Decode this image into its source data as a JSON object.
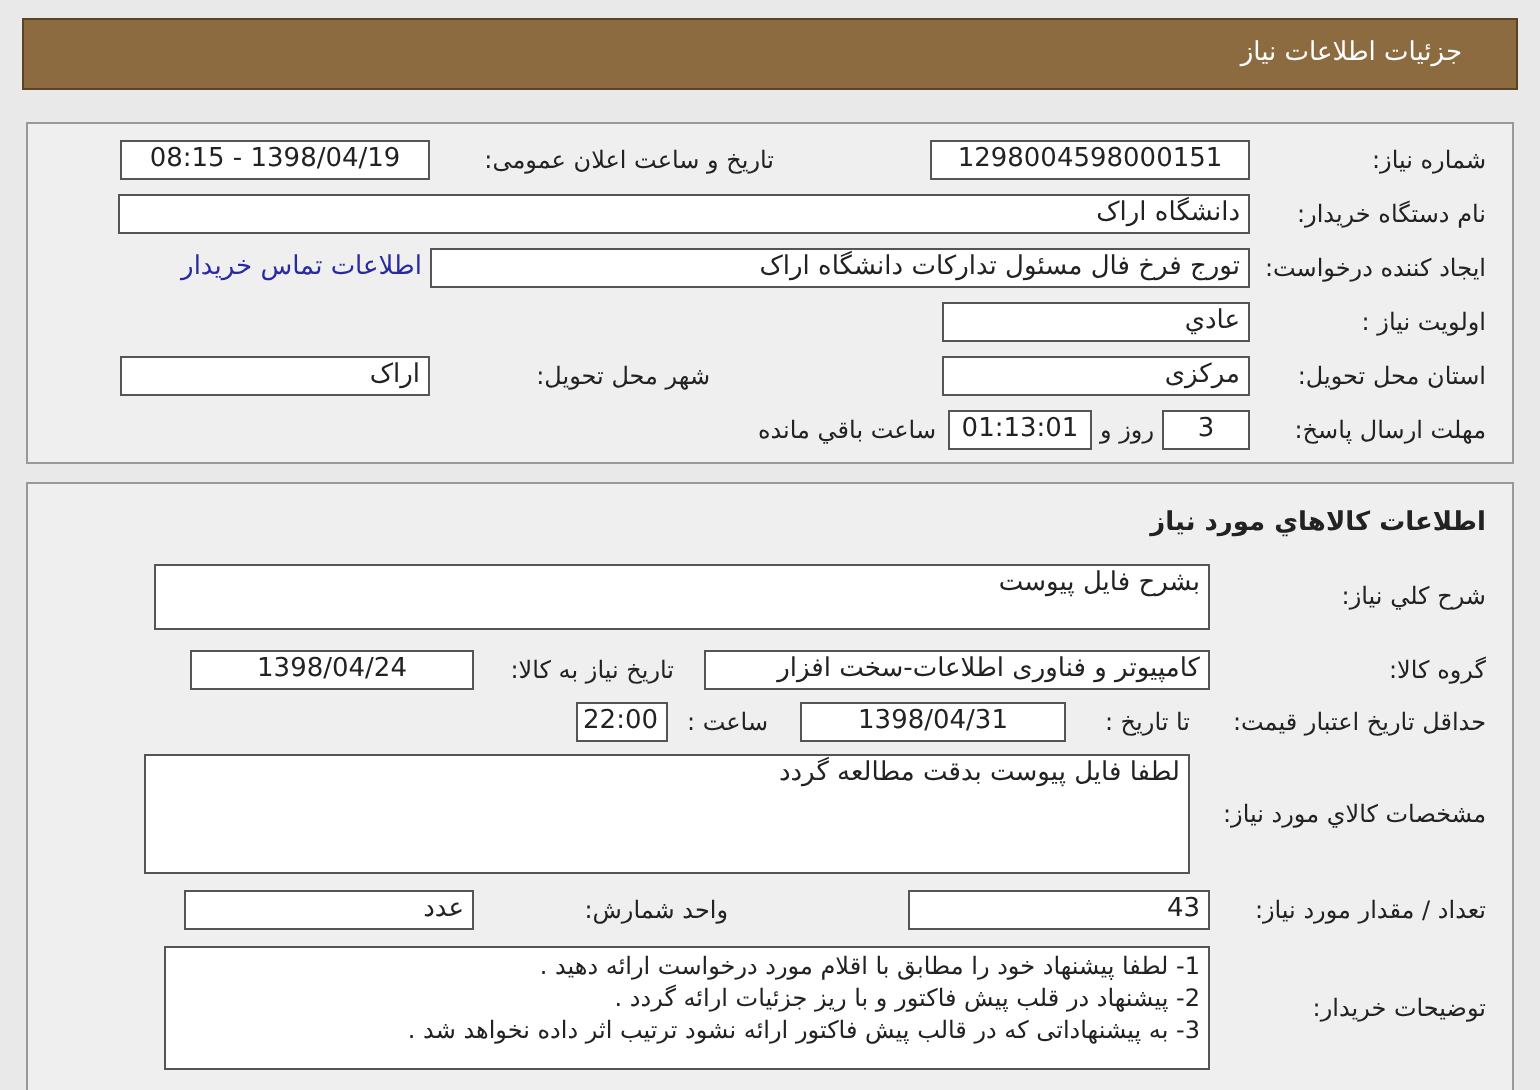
{
  "header": {
    "title": "جزئیات اطلاعات نیاز"
  },
  "need": {
    "number_label": "شماره نیاز:",
    "number": "1298004598000151",
    "announce_label": "تاریخ و ساعت اعلان عمومی:",
    "announce": "1398/04/19 - 08:15",
    "buyer_label": "نام دستگاه خریدار:",
    "buyer": "دانشگاه اراک",
    "creator_label": "ایجاد کننده درخواست:",
    "creator": "تورج فرخ فال مسئول تدارکات دانشگاه اراک",
    "contact_link": "اطلاعات تماس خریدار",
    "priority_label": "اولویت نیاز :",
    "priority": "عادي",
    "province_label": "استان محل تحویل:",
    "province": "مرکزی",
    "city_label": "شهر محل تحویل:",
    "city": "اراک",
    "deadline_label": "مهلت ارسال پاسخ:",
    "days": "3",
    "days_suffix": "روز و",
    "time": "01:13:01",
    "time_suffix": "ساعت باقي مانده"
  },
  "goods": {
    "title": "اطلاعات کالاهاي مورد نياز",
    "summary_label": "شرح کلي نياز:",
    "summary": "بشرح فایل پیوست",
    "group_label": "گروه کالا:",
    "group": "کامپیوتر و فناوری اطلاعات-سخت افزار",
    "need_date_label": "تاریخ نیاز به کالا:",
    "need_date": "1398/04/24",
    "validity_label": "حداقل تاریخ اعتبار قیمت:",
    "until_label": "تا تاریخ :",
    "until": "1398/04/31",
    "hour_label": "ساعت :",
    "hour": "22:00",
    "spec_label": "مشخصات کالاي مورد نياز:",
    "spec": "لطفا فایل پیوست بدقت مطالعه گردد",
    "qty_label": "تعداد / مقدار مورد نیاز:",
    "qty": "43",
    "unit_label": "واحد شمارش:",
    "unit": "عدد",
    "notes_label": "توضیحات خریدار:",
    "notes": [
      "1- لطفا پیشنهاد خود را مطابق با اقلام مورد درخواست ارائه دهید .",
      "2- پیشنهاد در قلب پیش فاکتور و با ریز جزئیات ارائه گردد .",
      "3- به پیشنهاداتی که در قالب پیش فاکتور ارائه نشود ترتیب اثر داده نخواهد شد ."
    ]
  }
}
